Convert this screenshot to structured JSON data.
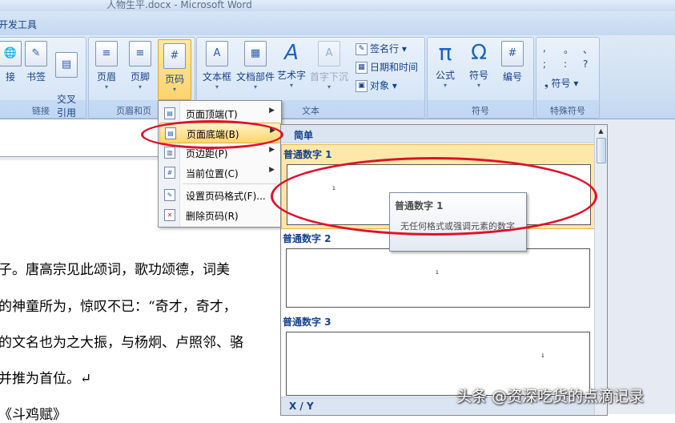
{
  "window": {
    "title": "人物生平.docx - Microsoft Word"
  },
  "ribbon_tab": {
    "label": "开发工具"
  },
  "ribbon": {
    "groups": [
      {
        "label": "链接",
        "buttons": [
          "接",
          "书签",
          "交叉\n引用"
        ]
      },
      {
        "label": "页眉和页",
        "buttons": [
          "页眉",
          "页脚",
          "页码"
        ]
      },
      {
        "label": "文本",
        "buttons": [
          "文本框",
          "文档部件",
          "艺术字",
          "首字下沉"
        ],
        "small": [
          "签名行",
          "日期和时间",
          "对象"
        ]
      },
      {
        "label": "符号",
        "buttons": [
          "公式",
          "符号",
          "编号"
        ]
      },
      {
        "label": "特殊符号",
        "small": [
          "符号"
        ]
      }
    ],
    "symbols_grid": [
      ",",
      "。",
      "、",
      ";",
      ":",
      "?"
    ]
  },
  "page_number_menu": {
    "items": [
      {
        "label": "页面顶端(T)",
        "submenu": true
      },
      {
        "label": "页面底端(B)",
        "submenu": true,
        "highlighted": true
      },
      {
        "label": "页边距(P)",
        "submenu": true
      },
      {
        "label": "当前位置(C)",
        "submenu": true
      },
      {
        "label": "设置页码格式(F)...",
        "submenu": false
      },
      {
        "label": "删除页码(R)",
        "submenu": false
      }
    ]
  },
  "gallery": {
    "section": "简单",
    "items": [
      {
        "title": "普通数字 1",
        "preview_number": "1"
      },
      {
        "title": "普通数字 2",
        "preview_number": "1"
      },
      {
        "title": "普通数字 3",
        "preview_number": "1"
      }
    ],
    "next_section": "X / Y"
  },
  "tooltip": {
    "title": "普通数字 1",
    "description": "无任何格式或强调元素的数字"
  },
  "document": {
    "lines": [
      "子。唐高宗见此颂词，歌功颂德，词美",
      "的神童所为，惊叹不已：“奇才，奇才，",
      "的文名也为之大振，与杨炯、卢照邻、骆",
      "   并推为首位。↵",
      "《斗鸡赋》"
    ]
  },
  "watermark": "头条 @资深吃货的点滴记录",
  "colors": {
    "highlight": "#ffd56a",
    "annotation_red": "#e0102a",
    "ribbon_text": "#15428b"
  }
}
